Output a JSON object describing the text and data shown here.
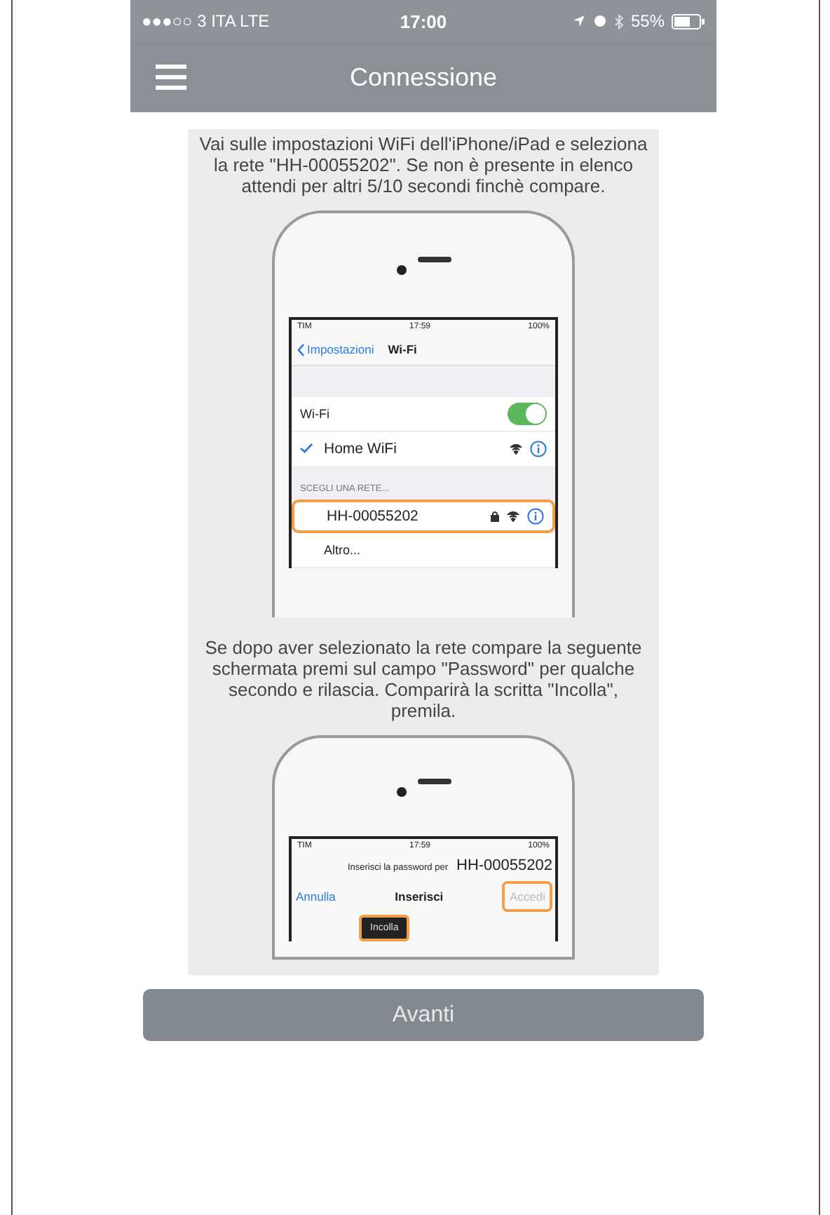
{
  "status_bar": {
    "carrier": "●●●○○ 3 ITA  LTE",
    "time": "17:00",
    "battery": "55%"
  },
  "header": {
    "title": "Connessione"
  },
  "instructions": [
    {
      "text": "Vai sulle impostazioni WiFi dell'iPhone/iPad e seleziona la rete \"HH-00055202\". Se non è presente in elenco attendi per altri 5/10 secondi finchè compare."
    },
    {
      "text": "Se dopo aver selezionato la rete compare la seguente schermata premi sul campo \"Password\" per qualche secondo e rilascia. Comparirà la scritta \"Incolla\", premila."
    }
  ],
  "wifi_screenshot": {
    "status": {
      "carrier": "TIM",
      "time": "17:59",
      "battery": "100%"
    },
    "back": "Impostazioni",
    "title": "Wi-Fi",
    "toggle": {
      "label": "Wi-Fi",
      "on": true
    },
    "current": {
      "name": "Home WiFi",
      "checked": true
    },
    "section": "SCEGLI UNA RETE...",
    "networks": [
      {
        "name": "HH-00055202",
        "highlighted": true
      }
    ],
    "other": "Altro..."
  },
  "password_screenshot": {
    "status": {
      "carrier": "TIM",
      "time": "17:59",
      "battery": "100%"
    },
    "prompt": "Inserisci la password per",
    "network": "HH-00055202",
    "cancel": "Annulla",
    "title": "Inserisci",
    "confirm": {
      "label": "Accedi",
      "disabled": true,
      "highlighted": true
    },
    "paste": "Incolla"
  },
  "next_button": "Avanti"
}
